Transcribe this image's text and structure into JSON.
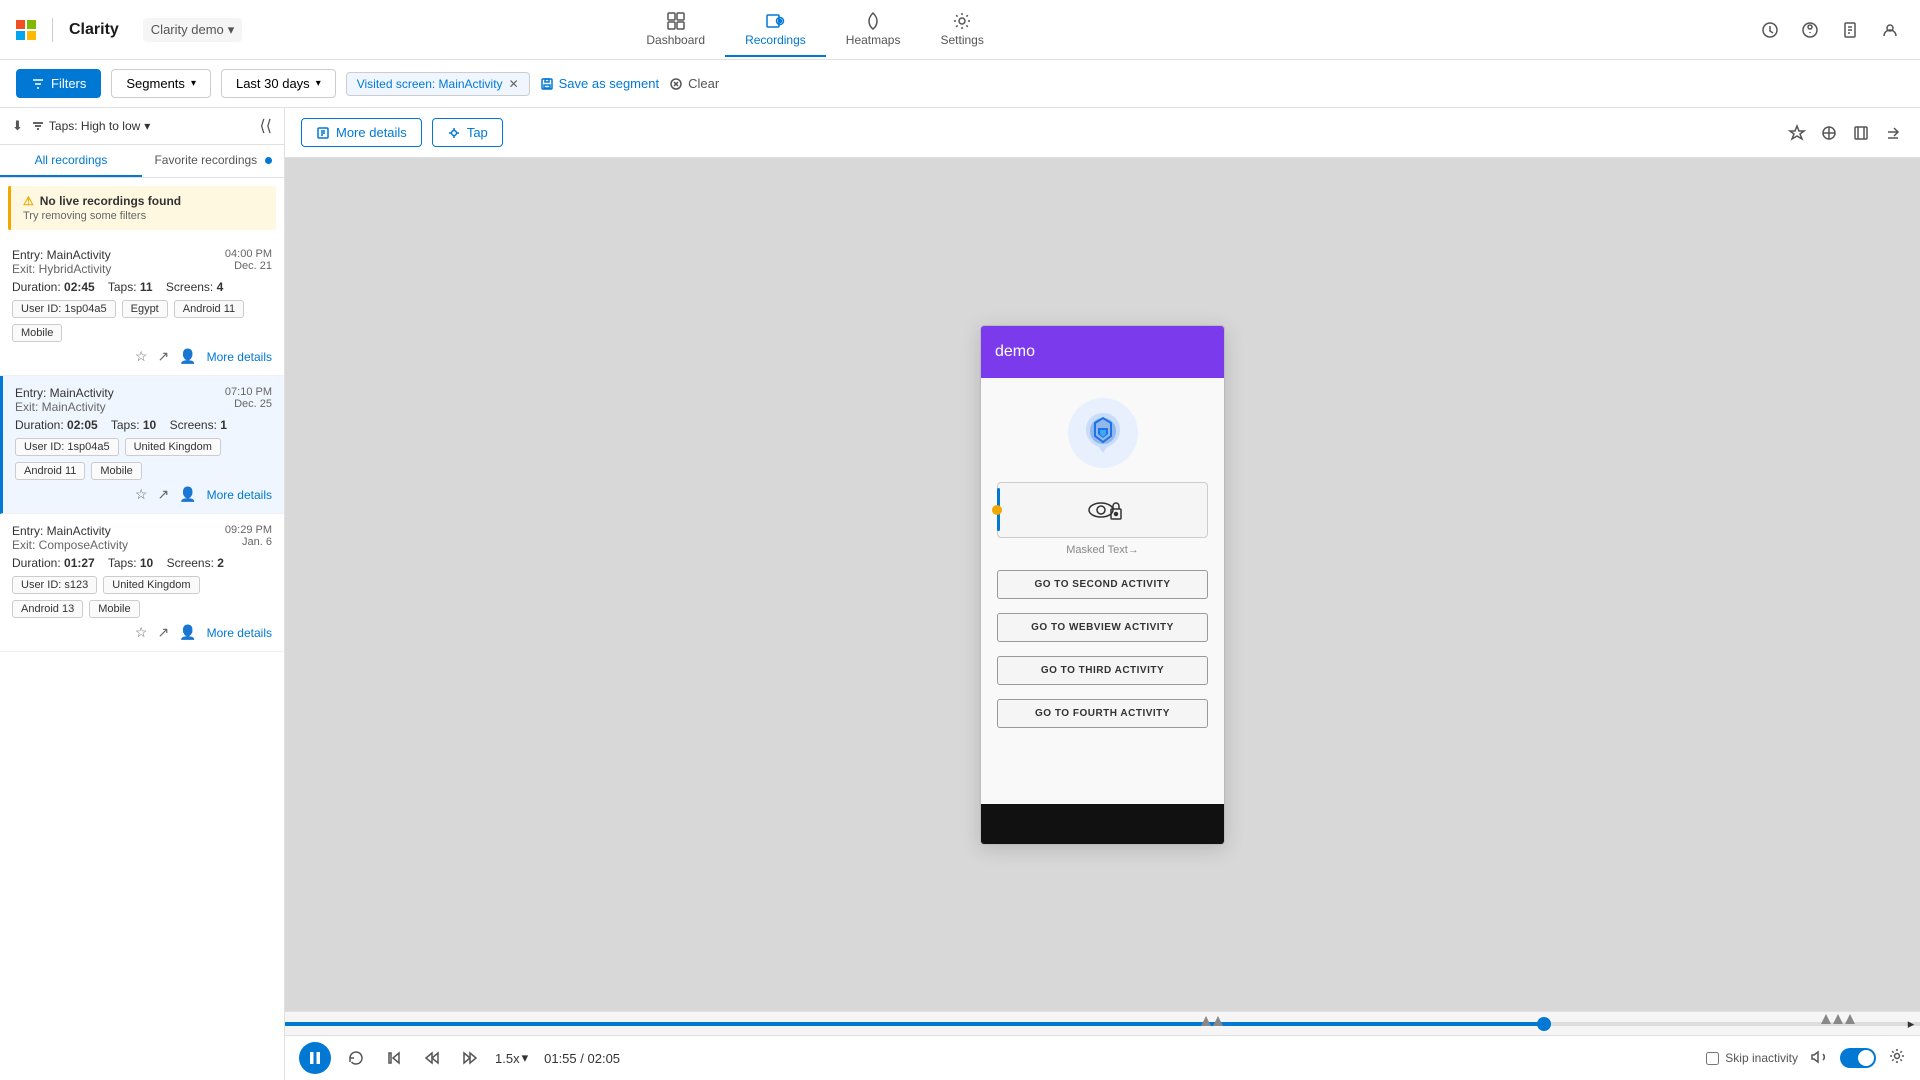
{
  "topbar": {
    "ms_icon": "⊞",
    "app_name": "Clarity",
    "project_name": "Clarity demo",
    "nav": [
      {
        "id": "dashboard",
        "label": "Dashboard",
        "active": false
      },
      {
        "id": "recordings",
        "label": "Recordings",
        "active": true
      },
      {
        "id": "heatmaps",
        "label": "Heatmaps",
        "active": false
      },
      {
        "id": "settings",
        "label": "Settings",
        "active": false
      }
    ]
  },
  "filters": {
    "filters_label": "Filters",
    "segments_label": "Segments",
    "date_range_label": "Last 30 days",
    "filter_chip_label": "Visited screen: MainActivity",
    "save_segment_label": "Save as segment",
    "clear_label": "Clear"
  },
  "sidebar": {
    "sort_label": "Taps: High to low",
    "tabs": [
      {
        "id": "all",
        "label": "All recordings",
        "active": true,
        "dot": false
      },
      {
        "id": "favorite",
        "label": "Favorite recordings",
        "active": false,
        "dot": true
      }
    ],
    "no_recordings": {
      "title": "No live recordings found",
      "subtitle": "Try removing some filters"
    },
    "recordings": [
      {
        "entry": "Entry: MainActivity",
        "exit": "Exit: HybridActivity",
        "time": "04:00 PM",
        "date": "Dec. 21",
        "duration_label": "Duration:",
        "duration": "02:45",
        "taps_label": "Taps:",
        "taps": "11",
        "screens_label": "Screens:",
        "screens": "4",
        "user_id": "User ID: 1sp04a5",
        "country": "Egypt",
        "os": "Android 11",
        "device": "Mobile"
      },
      {
        "entry": "Entry: MainActivity",
        "exit": "Exit: MainActivity",
        "time": "07:10 PM",
        "date": "Dec. 25",
        "duration_label": "Duration:",
        "duration": "02:05",
        "taps_label": "Taps:",
        "taps": "10",
        "screens_label": "Screens:",
        "screens": "1",
        "user_id": "User ID: 1sp04a5",
        "country": "United Kingdom",
        "os": "Android 11",
        "device": "Mobile"
      },
      {
        "entry": "Entry: MainActivity",
        "exit": "Exit: ComposeActivity",
        "time": "09:29 PM",
        "date": "Jan. 6",
        "duration_label": "Duration:",
        "duration": "01:27",
        "taps_label": "Taps:",
        "taps": "10",
        "screens_label": "Screens:",
        "screens": "2",
        "user_id": "User ID: s123",
        "country": "United Kingdom",
        "os": "Android 13",
        "device": "Mobile"
      }
    ],
    "more_details": "More details"
  },
  "content": {
    "more_details_btn": "More details",
    "tap_btn": "Tap",
    "phone": {
      "header_text": "demo",
      "masked_text": "Masked Text→",
      "buttons": [
        "GO TO SECOND ACTIVITY",
        "GO TO WEBVIEW ACTIVITY",
        "GO TO THIRD ACTIVITY",
        "GO TO FOURTH ACTIVITY"
      ]
    }
  },
  "player": {
    "current_time": "01:55",
    "total_time": "02:05",
    "speed": "1.5x",
    "skip_inactivity": "Skip inactivity"
  },
  "colors": {
    "brand": "#0078d4",
    "accent_purple": "#7c3aed",
    "accent_orange": "#f0a800"
  }
}
